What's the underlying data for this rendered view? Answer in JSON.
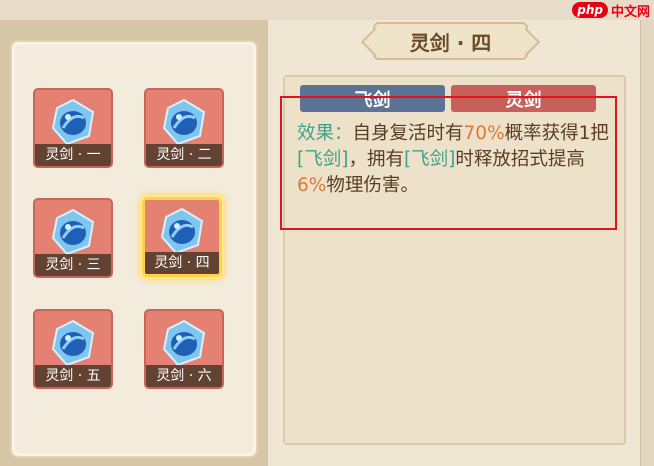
{
  "watermark": {
    "logo": "php",
    "site": "中文网"
  },
  "title": "灵剑 · 四",
  "tabs": [
    {
      "label": "飞剑",
      "color": "#5d7395"
    },
    {
      "label": "灵剑",
      "color": "#c85f5a"
    }
  ],
  "description": {
    "prefix": "效果：",
    "p1": "自身复活时有",
    "pct1": "70%",
    "p2": "概率获得1把",
    "ref1": "[飞剑]",
    "p3": "，拥有",
    "ref2": "[飞剑]",
    "p4": "时释放招式提高",
    "pct2": "6%",
    "p5": "物理伤害。"
  },
  "slots": [
    {
      "label": "灵剑 · 一",
      "selected": false
    },
    {
      "label": "灵剑 · 二",
      "selected": false
    },
    {
      "label": "灵剑 · 三",
      "selected": false
    },
    {
      "label": "灵剑 · 四",
      "selected": true
    },
    {
      "label": "灵剑 · 五",
      "selected": false
    },
    {
      "label": "灵剑 · 六",
      "selected": false
    }
  ],
  "colors": {
    "highlight_box": "#e0141e",
    "keyword_green": "#3ca38b",
    "value_orange": "#d77a3a",
    "slot_bg": "#e48172",
    "selected_border": "#ffd24a"
  },
  "icons": {
    "slot_item": "blue-gem-icon",
    "watermark_logo": "php-logo-icon"
  }
}
